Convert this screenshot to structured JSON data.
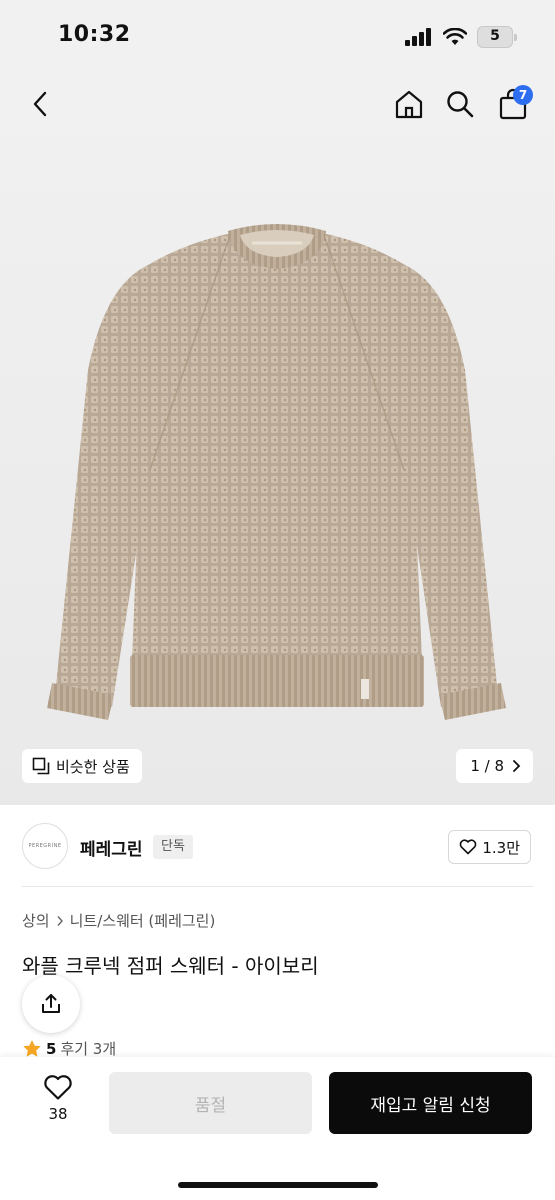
{
  "status_bar": {
    "time": "10:32",
    "battery": "5"
  },
  "nav": {
    "cart_count": "7",
    "icons": [
      "back-icon",
      "home-icon",
      "search-icon",
      "bag-icon"
    ]
  },
  "gallery": {
    "similar_label": "비슷한 상품",
    "page": "1 / 8"
  },
  "brand": {
    "logo_text": "PEREGRINE",
    "name": "페레그린",
    "badge": "단독",
    "likes": "1.3만"
  },
  "breadcrumb": {
    "level1": "상의",
    "level2": "니트/스웨터 (페레그린)"
  },
  "product": {
    "title": "와플 크루넥 점퍼 스웨터 - 아이보리",
    "rating": "5",
    "reviews": "후기 3개"
  },
  "bottom_bar": {
    "wish_count": "38",
    "soldout_label": "품절",
    "restock_label": "재입고 알림 신청"
  },
  "colors": {
    "accent_badge": "#2d6ef0",
    "primary_button": "#0b0b0b",
    "rating_star": "#f5a623"
  }
}
